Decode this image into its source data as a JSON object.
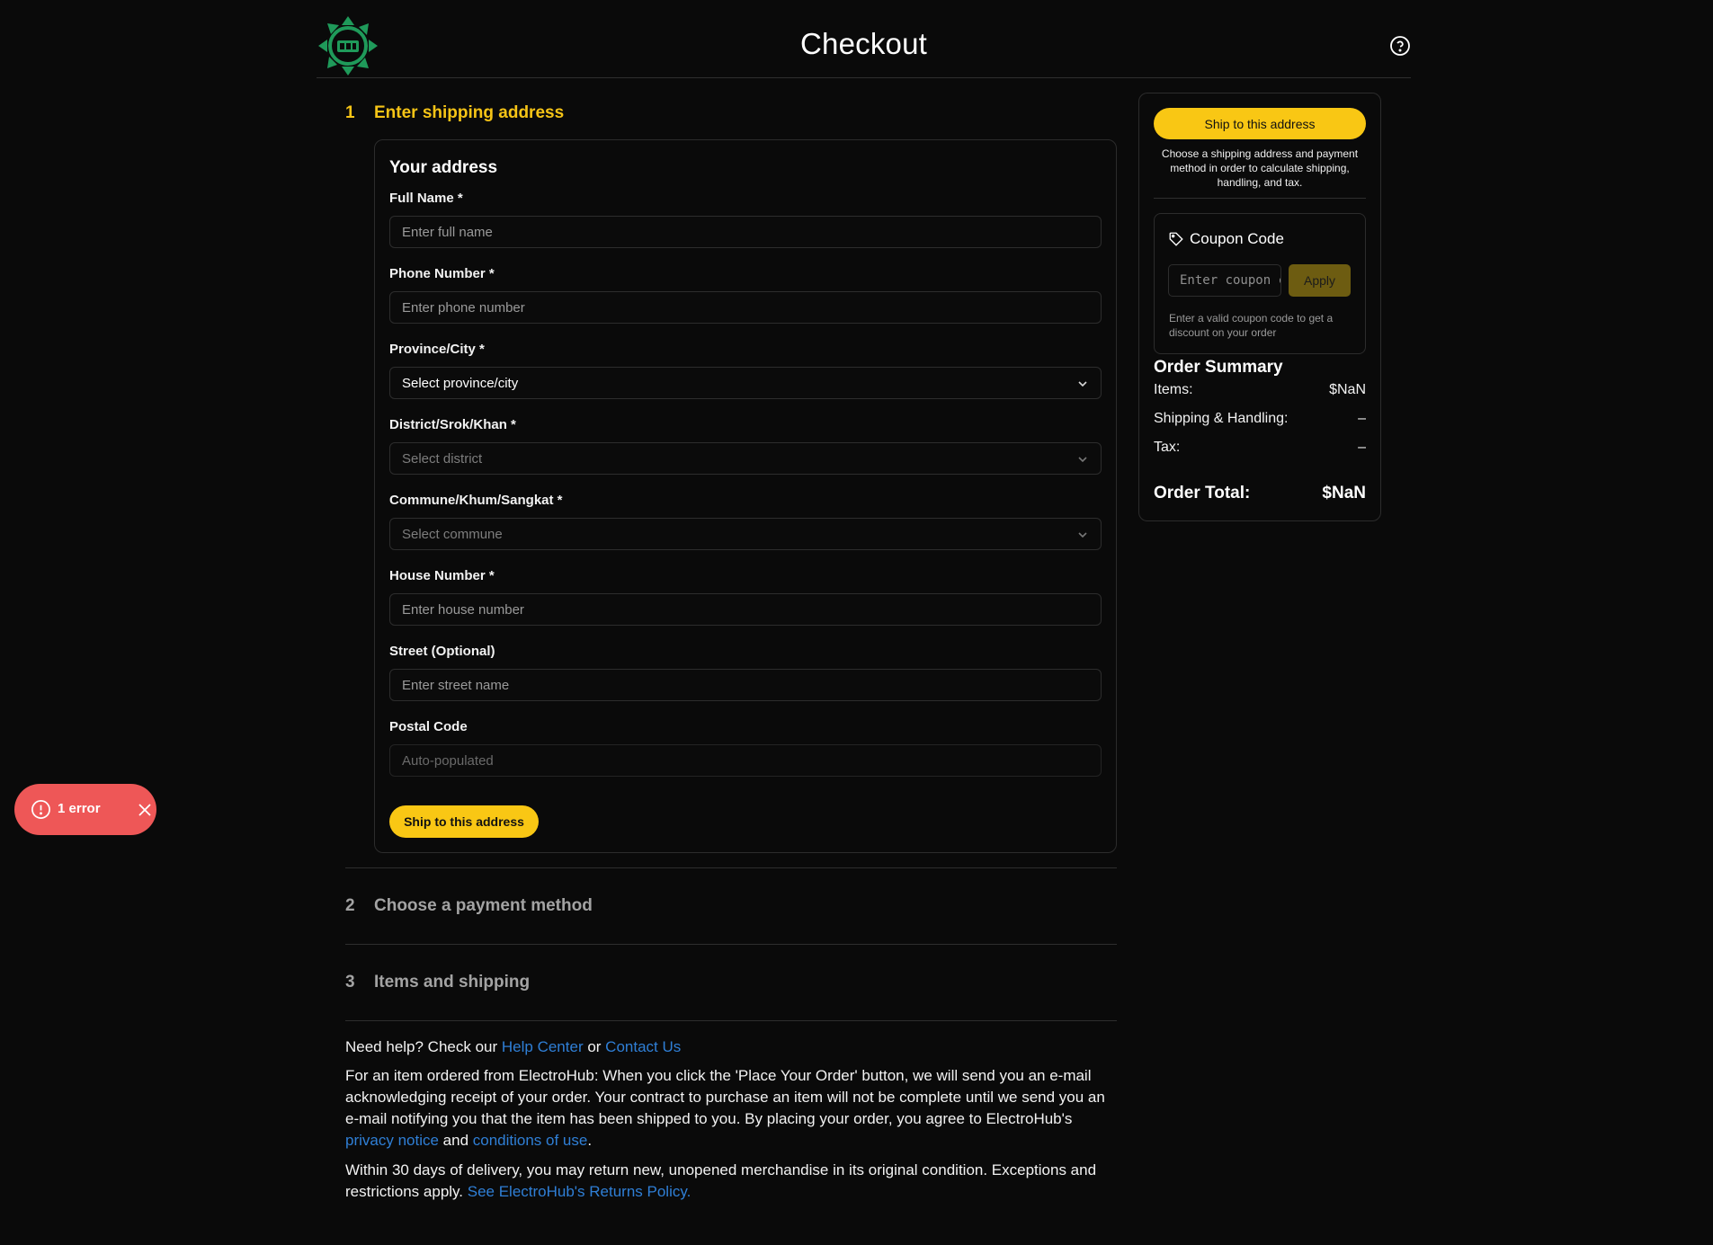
{
  "header": {
    "title": "Checkout",
    "logo_icon": "electrohub-logo-icon",
    "help_icon": "help-circle-icon"
  },
  "steps": [
    {
      "number": "1",
      "label": "Enter shipping address"
    },
    {
      "number": "2",
      "label": "Choose a payment method"
    },
    {
      "number": "3",
      "label": "Items and shipping"
    }
  ],
  "address_form": {
    "title": "Your address",
    "fields": [
      {
        "label": "Full Name *",
        "placeholder": "Enter full name",
        "type": "input"
      },
      {
        "label": "Phone Number *",
        "placeholder": "Enter phone number",
        "type": "input"
      },
      {
        "label": "Province/City *",
        "placeholder": "Select province/city",
        "type": "select"
      },
      {
        "label": "District/Srok/Khan *",
        "placeholder": "Select district",
        "type": "select"
      },
      {
        "label": "Commune/Khum/Sangkat *",
        "placeholder": "Select commune",
        "type": "select"
      },
      {
        "label": "House Number *",
        "placeholder": "Enter house number",
        "type": "input"
      },
      {
        "label": "Street (Optional)",
        "placeholder": "Enter street name",
        "type": "input"
      },
      {
        "label": "Postal Code",
        "placeholder": "Auto-populated",
        "type": "input"
      }
    ],
    "submit_label": "Ship to this address"
  },
  "footer": {
    "help_prefix": "Need help? Check our ",
    "help_center": "Help Center",
    "help_or": " or ",
    "contact_us": "Contact Us",
    "notice_text": "For an item ordered from ElectroHub: When you click the 'Place Your Order' button, we will send you an e-mail acknowledging receipt of your order. Your contract to purchase an item will not be complete until we send you an e-mail notifying you that the item has been shipped to you. By placing your order, you agree to ElectroHub's ",
    "privacy_notice": "privacy notice",
    "and": " and ",
    "conditions": "conditions of use",
    "period": ".",
    "returns_text": "Within 30 days of delivery, you may return new, unopened merchandise in its original condition. Exceptions and restrictions apply. ",
    "returns_link": "See ElectroHub's Returns Policy."
  },
  "sidebar": {
    "ship_button": "Ship to this address",
    "note": "Choose a shipping address and payment method in order to calculate shipping, handling, and tax.",
    "coupon": {
      "title": "Coupon Code",
      "icon": "tag-icon",
      "placeholder": "Enter coupon code",
      "apply_label": "Apply",
      "help": "Enter a valid coupon code to get a discount on your order"
    },
    "summary": {
      "title": "Order Summary",
      "items_label": "Items:",
      "items_value": "$NaN",
      "shipping_label": "Shipping & Handling:",
      "shipping_value": "–",
      "tax_label": "Tax:",
      "tax_value": "–",
      "total_label": "Order Total:",
      "total_value": "$NaN"
    }
  },
  "toast": {
    "text": "1 error",
    "icon": "alert-circle-icon",
    "close_icon": "close-icon"
  },
  "colors": {
    "accent": "#f9c714",
    "link": "#2f7fd6",
    "error": "#ee5757",
    "background": "#0a0a0a"
  }
}
